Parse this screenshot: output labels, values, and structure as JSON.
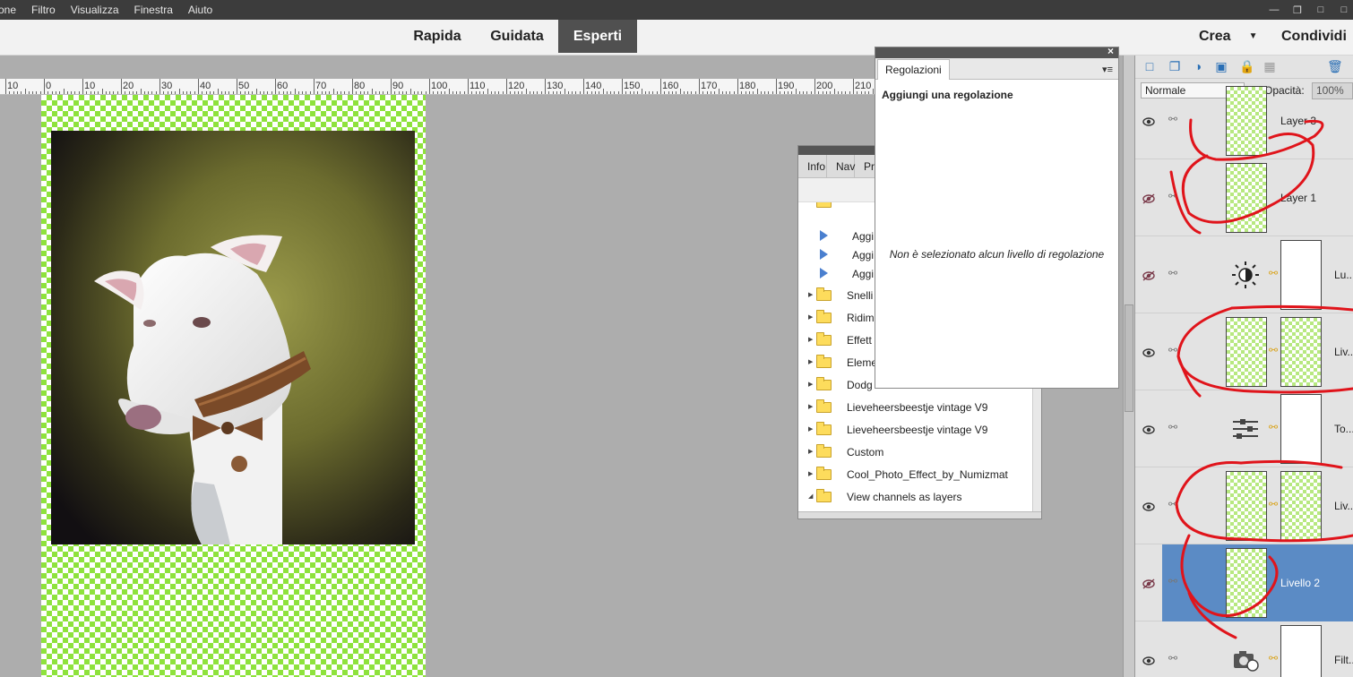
{
  "menubar": {
    "items": [
      "one",
      "Filtro",
      "Visualizza",
      "Finestra",
      "Aiuto"
    ]
  },
  "modes": {
    "tabs": [
      {
        "label": "Rapida"
      },
      {
        "label": "Guidata"
      },
      {
        "label": "Esperti",
        "active": true
      }
    ],
    "crea": "Crea",
    "condividi": "Condividi"
  },
  "ruler": {
    "labels": [
      "10",
      "0",
      "10",
      "20",
      "30",
      "40",
      "50",
      "60",
      "70",
      "80",
      "90",
      "100",
      "110",
      "120",
      "130",
      "140",
      "150",
      "160",
      "170",
      "180",
      "190",
      "200",
      "210"
    ]
  },
  "actions_panel": {
    "tabs": [
      "Info",
      "Nav",
      "Pre"
    ],
    "rows": [
      {
        "kind": "play",
        "label": "Aggi"
      },
      {
        "kind": "play",
        "label": "Aggi"
      },
      {
        "kind": "play",
        "label": "Aggi"
      },
      {
        "kind": "folder",
        "label": "Snelli"
      },
      {
        "kind": "folder",
        "label": "Ridim"
      },
      {
        "kind": "folder",
        "label": "Effett"
      },
      {
        "kind": "folder",
        "label": "Eleme"
      },
      {
        "kind": "folder",
        "label": "Dodg"
      },
      {
        "kind": "folder",
        "label": "Lieveheersbeestje vintage V9"
      },
      {
        "kind": "folder",
        "label": "Lieveheersbeestje vintage V9"
      },
      {
        "kind": "folder",
        "label": "Custom"
      },
      {
        "kind": "folder",
        "label": "Cool_Photo_Effect_by_Numizmat"
      },
      {
        "kind": "folder-open",
        "label": "View channels as layers"
      },
      {
        "kind": "down",
        "label": "View channels as layers"
      }
    ]
  },
  "adjustments_panel": {
    "tab": "Regolazioni",
    "heading": "Aggiungi una regolazione",
    "message": "Non è selezionato alcun livello di regolazione"
  },
  "layers_panel": {
    "blend_mode": "Normale",
    "opacity_label": "Opacità:",
    "opacity_value": "100%",
    "layers": [
      {
        "name": "Layer 3",
        "visible": true
      },
      {
        "name": "Layer 1",
        "visible": false
      },
      {
        "name": "Lu...",
        "visible": false,
        "type": "brightness"
      },
      {
        "name": "Liv...",
        "visible": true,
        "type": "masked"
      },
      {
        "name": "To...",
        "visible": true,
        "type": "levels"
      },
      {
        "name": "Liv...",
        "visible": true,
        "type": "masked"
      },
      {
        "name": "Livello 2",
        "visible": false,
        "selected": true
      },
      {
        "name": "Filt...",
        "visible": true,
        "type": "photo-filter"
      }
    ]
  },
  "colors": {
    "accent_selected": "#5b8bc5",
    "checker_green": "#8ee23c",
    "scribble_red": "#e0141b"
  }
}
